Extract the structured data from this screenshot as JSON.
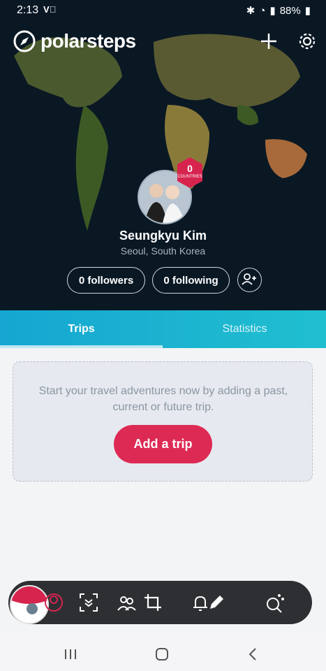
{
  "status_bar": {
    "time": "2:13",
    "carrier_icon": "vi-icon",
    "battery": "88%"
  },
  "brand": {
    "name": "polarsteps"
  },
  "profile": {
    "countries_count": "0",
    "countries_label": "COUNTRIES",
    "name": "Seungkyu Kim",
    "location": "Seoul, South Korea",
    "followers": "0 followers",
    "following": "0 following"
  },
  "tabs": [
    {
      "label": "Trips",
      "active": true
    },
    {
      "label": "Statistics",
      "active": false
    }
  ],
  "empty_state": {
    "message": "Start your travel adventures now by adding a past, current or future trip.",
    "button": "Add a trip"
  },
  "colors": {
    "accent": "#dd2a54",
    "tab_bg": "#16a6d1",
    "toolbar": "#2e2f33"
  }
}
